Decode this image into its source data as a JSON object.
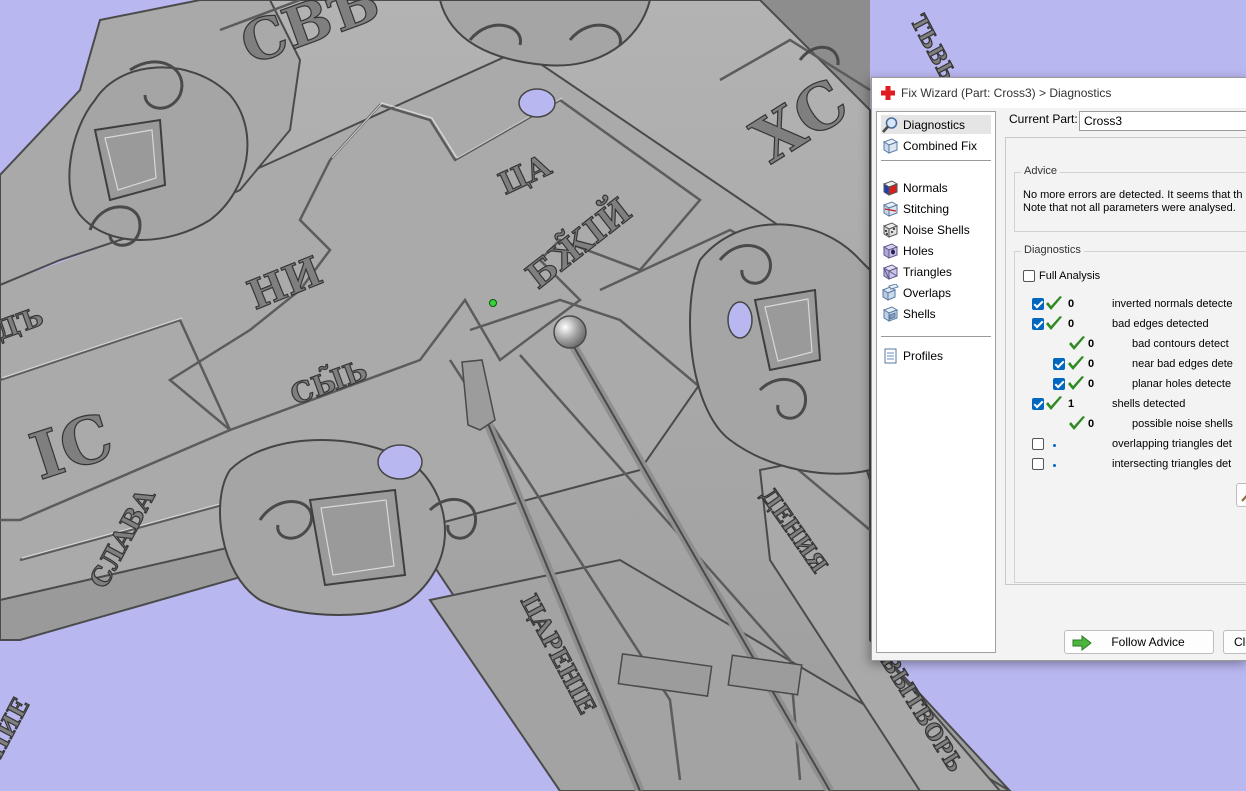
{
  "window": {
    "title": "Fix Wizard (Part: Cross3) > Diagnostics"
  },
  "nav": {
    "items": [
      {
        "label": "Diagnostics",
        "icon": "magnifier-icon",
        "selected": true
      },
      {
        "label": "Combined Fix",
        "icon": "cube-outline-icon"
      },
      {
        "label": "Normals",
        "icon": "normals-cube-icon"
      },
      {
        "label": "Stitching",
        "icon": "stitching-cube-icon"
      },
      {
        "label": "Noise Shells",
        "icon": "noise-shells-icon"
      },
      {
        "label": "Holes",
        "icon": "holes-cube-icon"
      },
      {
        "label": "Triangles",
        "icon": "triangles-cube-icon"
      },
      {
        "label": "Overlaps",
        "icon": "overlaps-icon"
      },
      {
        "label": "Shells",
        "icon": "shells-icon"
      },
      {
        "label": "Profiles",
        "icon": "document-icon"
      }
    ]
  },
  "current_part": {
    "label": "Current Part:",
    "value": "Cross3"
  },
  "advice": {
    "label": "Advice",
    "line1": "No more errors are detected. It seems that th",
    "line2": "Note that not all parameters were analysed."
  },
  "diagnostics": {
    "label": "Diagnostics",
    "full_analysis_label": "Full Analysis",
    "full_analysis_checked": false,
    "rows": [
      {
        "checked": true,
        "ok": true,
        "count": "0",
        "label": "inverted normals detecte"
      },
      {
        "checked": true,
        "ok": true,
        "count": "0",
        "label": "bad edges detected"
      },
      {
        "checked": null,
        "ok": true,
        "count": "0",
        "label": "bad contours detect"
      },
      {
        "checked": true,
        "ok": true,
        "count": "0",
        "label": "near bad edges dete"
      },
      {
        "checked": true,
        "ok": true,
        "count": "0",
        "label": "planar holes detecte"
      },
      {
        "checked": true,
        "ok": true,
        "count": "1",
        "label": "shells detected"
      },
      {
        "checked": null,
        "ok": true,
        "count": "0",
        "label": "possible noise shells"
      },
      {
        "checked": false,
        "ok": false,
        "count": "",
        "label": "overlapping triangles det"
      },
      {
        "checked": false,
        "ok": false,
        "count": "",
        "label": "intersecting triangles det"
      }
    ]
  },
  "buttons": {
    "follow_advice": "Follow Advice",
    "close": "Clo"
  },
  "viewport": {
    "glyphs": {
      "ic": "IC",
      "hi": "НИ",
      "syn": "СЫ̃Ь",
      "bzhiy": "БЖ̃ІЙ",
      "ka": "ЦА",
      "sve": "СВѢ",
      "xc": "ХС",
      "slava": "СЛАВА",
      "left_edge": "ДЪ",
      "right_top": "ТЬВЬ",
      "right_bottom": "ДЕНИЯ",
      "right_edge": "ВЫТВОРЬ",
      "bottom_mid": "ЦАРЕНІЕ",
      "left_bottom": "НИЕ"
    }
  },
  "colors": {
    "background": "#b9b7f0",
    "model_grey": "#a6a6a6",
    "accent": "#0067c0",
    "check_green": "#2e8b22"
  }
}
